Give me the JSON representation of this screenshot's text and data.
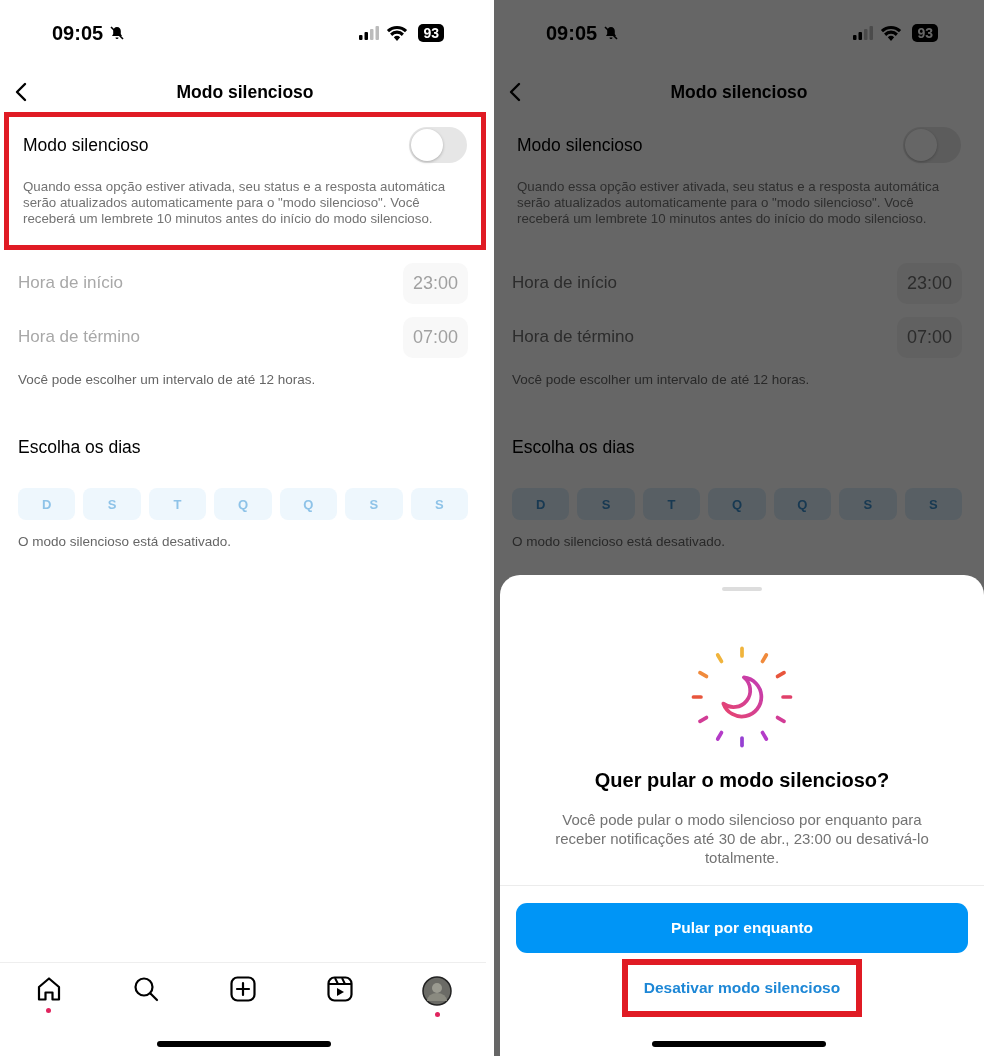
{
  "screens": [
    {
      "status_bar": {
        "time": "09:05",
        "battery": "93"
      },
      "title": "Modo silencioso",
      "setting": {
        "label": "Modo silencioso",
        "on": false,
        "highlighted": true,
        "description": "Quando essa opção estiver ativada, seu status e a resposta automática serão atualizados automaticamente para o \"modo silencioso\". Você receberá um lembrete 10 minutos antes do início do modo silencioso."
      },
      "times": [
        {
          "label": "Hora de início",
          "value": "23:00"
        },
        {
          "label": "Hora de término",
          "value": "07:00"
        }
      ],
      "interval_note": "Você pode escolher um intervalo de até 12 horas.",
      "days_heading": "Escolha os dias",
      "days": [
        "D",
        "S",
        "T",
        "Q",
        "Q",
        "S",
        "S"
      ],
      "status_note": "O modo silencioso está desativado.",
      "dimmed": false,
      "tab_bar": [
        {
          "kind": "home",
          "badge": true
        },
        {
          "kind": "search",
          "badge": false
        },
        {
          "kind": "create",
          "badge": false
        },
        {
          "kind": "reels",
          "badge": false
        },
        {
          "kind": "profile",
          "badge": true
        }
      ]
    },
    {
      "status_bar": {
        "time": "09:05",
        "battery": "93"
      },
      "title": "Modo silencioso",
      "setting": {
        "label": "Modo silencioso",
        "on": false,
        "highlighted": false,
        "description": "Quando essa opção estiver ativada, seu status e a resposta automática serão atualizados automaticamente para o \"modo silencioso\". Você receberá um lembrete 10 minutos antes do início do modo silencioso."
      },
      "times": [
        {
          "label": "Hora de início",
          "value": "23:00"
        },
        {
          "label": "Hora de término",
          "value": "07:00"
        }
      ],
      "interval_note": "Você pode escolher um intervalo de até 12 horas.",
      "days_heading": "Escolha os dias",
      "days": [
        "D",
        "S",
        "T",
        "Q",
        "Q",
        "S",
        "S"
      ],
      "status_note": "O modo silencioso está desativado.",
      "dimmed": true,
      "sheet": {
        "title": "Quer pular o modo silencioso?",
        "body": "Você pode pular o modo silencioso por enquanto para receber notificações até 30 de abr., 23:00 ou desativá-lo totalmente.",
        "primary_button": "Pular por enquanto",
        "secondary_button": {
          "label": "Desativar modo silencioso",
          "highlighted": true
        }
      }
    }
  ]
}
